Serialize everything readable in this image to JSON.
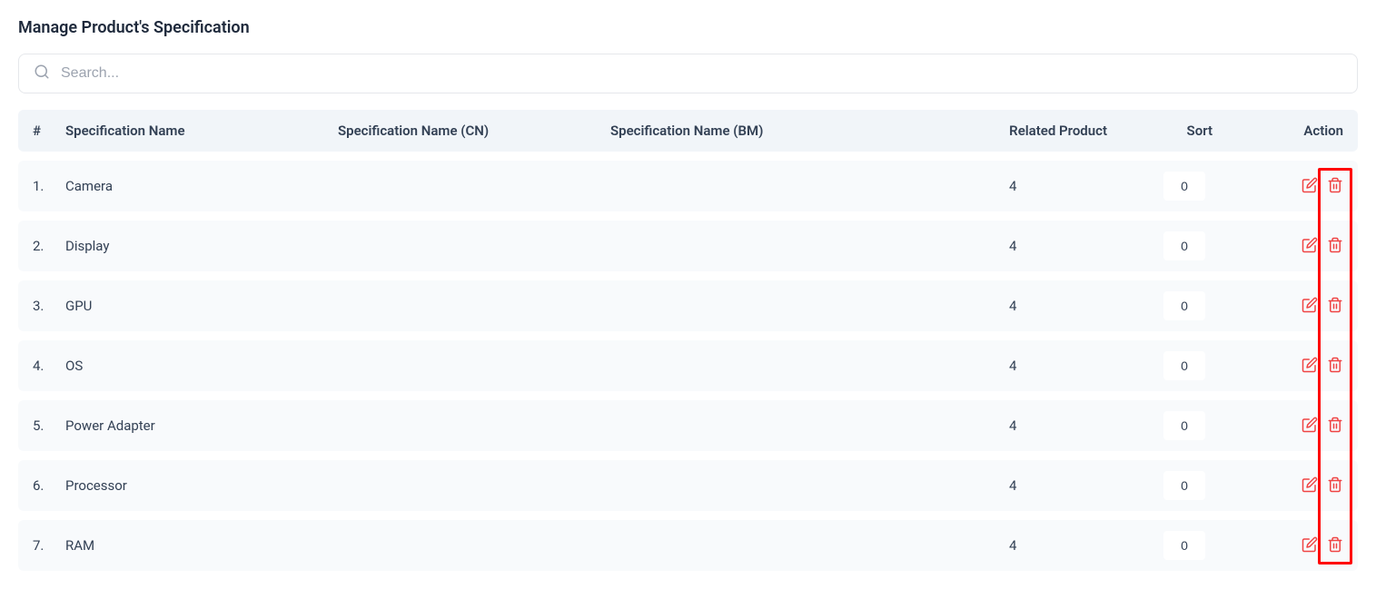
{
  "page": {
    "title": "Manage Product's Specification"
  },
  "search": {
    "placeholder": "Search..."
  },
  "columns": {
    "index": "#",
    "name": "Specification Name",
    "name_cn": "Specification Name (CN)",
    "name_bm": "Specification Name (BM)",
    "related": "Related Product",
    "sort": "Sort",
    "action": "Action"
  },
  "rows": [
    {
      "index": "1.",
      "name": "Camera",
      "name_cn": "",
      "name_bm": "",
      "related": "4",
      "sort": "0"
    },
    {
      "index": "2.",
      "name": "Display",
      "name_cn": "",
      "name_bm": "",
      "related": "4",
      "sort": "0"
    },
    {
      "index": "3.",
      "name": "GPU",
      "name_cn": "",
      "name_bm": "",
      "related": "4",
      "sort": "0"
    },
    {
      "index": "4.",
      "name": "OS",
      "name_cn": "",
      "name_bm": "",
      "related": "4",
      "sort": "0"
    },
    {
      "index": "5.",
      "name": "Power Adapter",
      "name_cn": "",
      "name_bm": "",
      "related": "4",
      "sort": "0"
    },
    {
      "index": "6.",
      "name": "Processor",
      "name_cn": "",
      "name_bm": "",
      "related": "4",
      "sort": "0"
    },
    {
      "index": "7.",
      "name": "RAM",
      "name_cn": "",
      "name_bm": "",
      "related": "4",
      "sort": "0"
    }
  ],
  "colors": {
    "action_icon": "#ef4444",
    "search_icon": "#9ca3af"
  }
}
